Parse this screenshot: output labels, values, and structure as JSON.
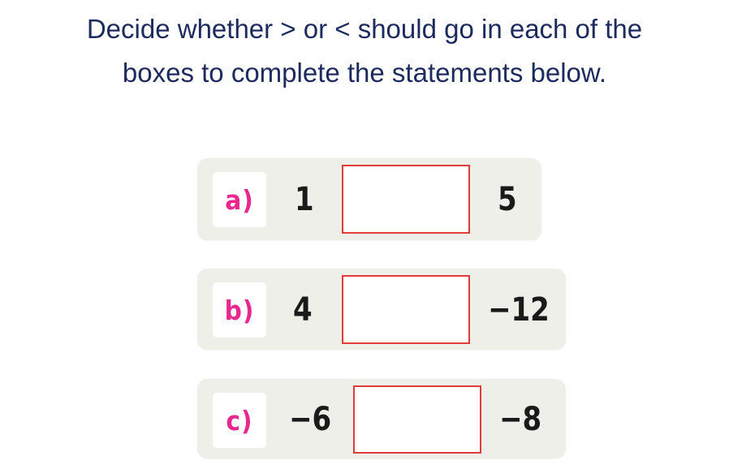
{
  "instructions": {
    "line1": "Decide whether > or < should go in each of the",
    "line2": "boxes to complete the statements below."
  },
  "questions": [
    {
      "label": "a)",
      "left": "1",
      "right": "5",
      "answer": ""
    },
    {
      "label": "b)",
      "left": "4",
      "right": "−12",
      "answer": ""
    },
    {
      "label": "c)",
      "left": "−6",
      "right": "−8",
      "answer": ""
    }
  ],
  "colors": {
    "title": "#1c2a5e",
    "label": "#e8278f",
    "box_border": "#e03c3c",
    "panel": "#efefea"
  }
}
